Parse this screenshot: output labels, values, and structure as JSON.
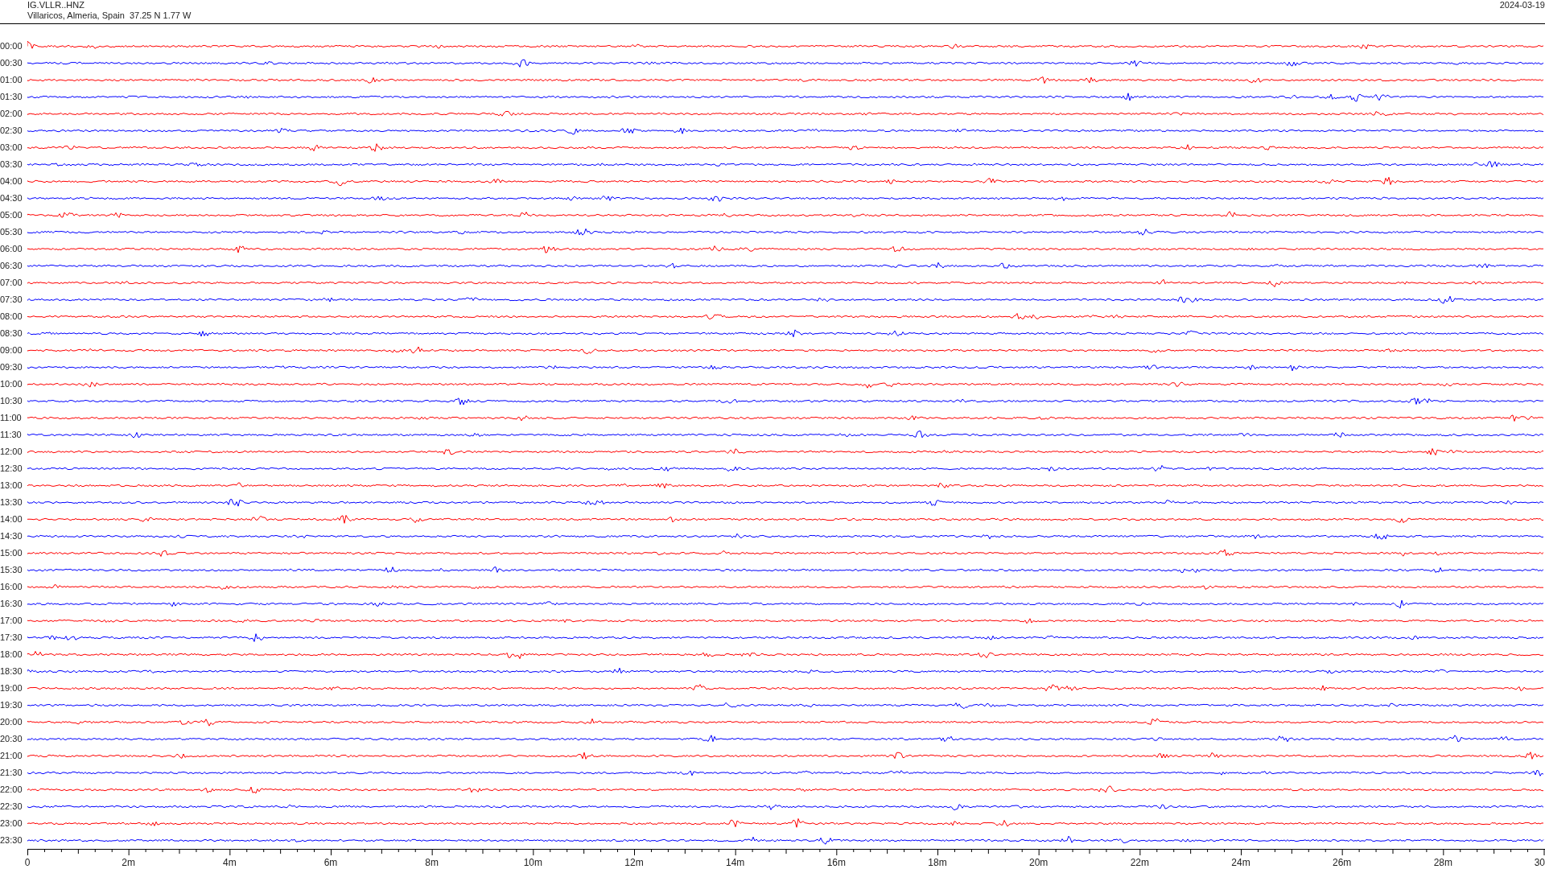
{
  "header": {
    "station": "IG.VLLR..HNZ",
    "location": "Villaricos, Almeria, Spain  37.25 N 1.77 W",
    "date": "2024-03-19"
  },
  "rows": [
    {
      "label": "00:00",
      "color": "#ff0000"
    },
    {
      "label": "00:30",
      "color": "#0000ff"
    },
    {
      "label": "01:00",
      "color": "#ff0000"
    },
    {
      "label": "01:30",
      "color": "#0000ff"
    },
    {
      "label": "02:00",
      "color": "#ff0000"
    },
    {
      "label": "02:30",
      "color": "#0000ff"
    },
    {
      "label": "03:00",
      "color": "#ff0000"
    },
    {
      "label": "03:30",
      "color": "#0000ff"
    },
    {
      "label": "04:00",
      "color": "#ff0000"
    },
    {
      "label": "04:30",
      "color": "#0000ff"
    },
    {
      "label": "05:00",
      "color": "#ff0000"
    },
    {
      "label": "05:30",
      "color": "#0000ff"
    },
    {
      "label": "06:00",
      "color": "#ff0000"
    },
    {
      "label": "06:30",
      "color": "#0000ff"
    },
    {
      "label": "07:00",
      "color": "#ff0000"
    },
    {
      "label": "07:30",
      "color": "#0000ff"
    },
    {
      "label": "08:00",
      "color": "#ff0000"
    },
    {
      "label": "08:30",
      "color": "#0000ff"
    },
    {
      "label": "09:00",
      "color": "#ff0000"
    },
    {
      "label": "09:30",
      "color": "#0000ff"
    },
    {
      "label": "10:00",
      "color": "#ff0000"
    },
    {
      "label": "10:30",
      "color": "#0000ff"
    },
    {
      "label": "11:00",
      "color": "#ff0000"
    },
    {
      "label": "11:30",
      "color": "#0000ff"
    },
    {
      "label": "12:00",
      "color": "#ff0000"
    },
    {
      "label": "12:30",
      "color": "#0000ff"
    },
    {
      "label": "13:00",
      "color": "#ff0000"
    },
    {
      "label": "13:30",
      "color": "#0000ff"
    },
    {
      "label": "14:00",
      "color": "#ff0000"
    },
    {
      "label": "14:30",
      "color": "#0000ff"
    },
    {
      "label": "15:00",
      "color": "#ff0000"
    },
    {
      "label": "15:30",
      "color": "#0000ff"
    },
    {
      "label": "16:00",
      "color": "#ff0000"
    },
    {
      "label": "16:30",
      "color": "#0000ff"
    },
    {
      "label": "17:00",
      "color": "#ff0000"
    },
    {
      "label": "17:30",
      "color": "#0000ff"
    },
    {
      "label": "18:00",
      "color": "#ff0000"
    },
    {
      "label": "18:30",
      "color": "#0000ff"
    },
    {
      "label": "19:00",
      "color": "#ff0000"
    },
    {
      "label": "19:30",
      "color": "#0000ff"
    },
    {
      "label": "20:00",
      "color": "#ff0000"
    },
    {
      "label": "20:30",
      "color": "#0000ff"
    },
    {
      "label": "21:00",
      "color": "#ff0000"
    },
    {
      "label": "21:30",
      "color": "#0000ff"
    },
    {
      "label": "22:00",
      "color": "#ff0000"
    },
    {
      "label": "22:30",
      "color": "#0000ff"
    },
    {
      "label": "23:00",
      "color": "#ff0000"
    },
    {
      "label": "23:30",
      "color": "#0000ff"
    }
  ],
  "axis": {
    "tick_labels": [
      "0",
      "2m",
      "4m",
      "6m",
      "8m",
      "10m",
      "12m",
      "14m",
      "16m",
      "18m",
      "20m",
      "22m",
      "24m",
      "26m",
      "28m",
      "30"
    ]
  }
}
